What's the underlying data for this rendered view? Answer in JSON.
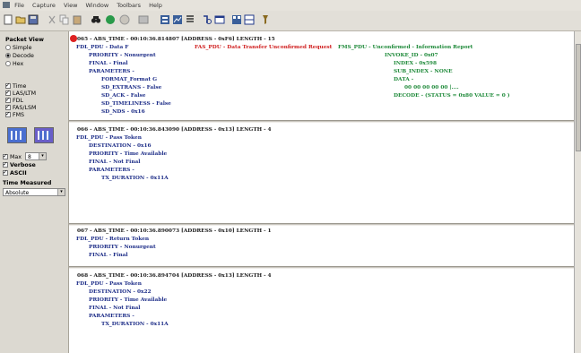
{
  "menu": [
    "File",
    "Capture",
    "View",
    "Window",
    "Toolbars",
    "Help"
  ],
  "toolbar_icons": [
    "new-icon",
    "open-icon",
    "save-icon",
    "cut-icon",
    "copy-icon",
    "paste-icon",
    "binoculars-icon",
    "record-icon",
    "stop-icon",
    "display-icon",
    "filter-icon",
    "graph-icon",
    "list-icon",
    "find-icon",
    "window-icon",
    "layout-icon",
    "pin-icon"
  ],
  "left": {
    "packet_view": "Packet View",
    "modes": [
      "Simple",
      "Decode",
      "Hex"
    ],
    "layers": [
      "Time",
      "LAS/LTM",
      "FDL",
      "FAS/LSM",
      "FMS"
    ],
    "max_label": "Max",
    "max_value": "8",
    "verbose": "Verbose",
    "ascii": "ASCII",
    "time_measured": "Time Measured",
    "time_value": "Absolute"
  },
  "packets": {
    "p1": {
      "header": "065 - ABS_TIME - 00:10:36.814807 [ADDRESS - 0xF6] LENGTH - 15",
      "fdl": "FDL_PDU - Data F",
      "priority": "PRIORITY - Nonurgent",
      "final": "FINAL - Final",
      "params": "PARAMETERS -",
      "format": "FORMAT_Format G",
      "extrans": "SD_EXTRANS - False",
      "ack": "SD_ACK - False",
      "timeliness": "SD_TIMELINESS - False",
      "nds": "SD_NDS - 0x16",
      "fas": "FAS_PDU - Data Transfer Unconfirmed Request",
      "fms": "FMS_PDU - Unconfirmed - Information Report",
      "invoke": "INVOKE_ID - 0x07",
      "index": "INDEX - 0x598",
      "subindex": "SUB_INDEX - NONE",
      "data": "DATA -",
      "bytes": "00 00 00 00 00  |....",
      "decode": "DECODE - (STATUS = 0x80 VALUE = 0 )"
    },
    "p2": {
      "header": "066 - ABS_TIME - 00:10:36.843090 [ADDRESS - 0x13] LENGTH - 4",
      "fdl": "FDL_PDU - Pass Token",
      "destination": "DESTINATION - 0x16",
      "priority": "PRIORITY - Time Available",
      "final": "FINAL - Not Final",
      "params": "PARAMETERS -",
      "duration": "TX_DURATION - 0x11A"
    },
    "p3": {
      "header": "067 - ABS_TIME - 00:10:36.890073 [ADDRESS - 0x10] LENGTH - 1",
      "fdl": "FDL_PDU - Return Token",
      "priority": "PRIORITY - Nonurgent",
      "final": "FINAL - Final"
    },
    "p4": {
      "header": "068 - ABS_TIME - 00:10:36.894704 [ADDRESS - 0x13] LENGTH - 4",
      "fdl": "FDL_PDU - Pass Token",
      "destination": "DESTINATION - 0x22",
      "priority": "PRIORITY - Time Available",
      "final": "FINAL - Not Final",
      "params": "PARAMETERS -",
      "duration": "TX_DURATION - 0x11A"
    }
  }
}
